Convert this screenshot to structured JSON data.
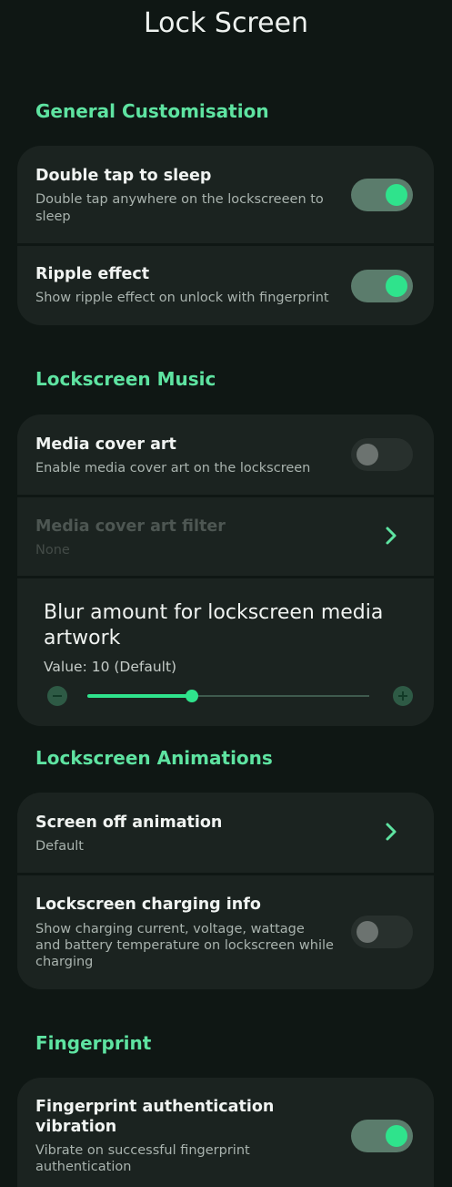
{
  "page_title": "Lock Screen",
  "accent_color": "#5ee3a1",
  "sections": {
    "general": {
      "header": "General Customisation",
      "items": [
        {
          "title": "Double tap to sleep",
          "subtitle_lines": [
            "Double tap anywhere on the lockscreeen to",
            "sleep"
          ],
          "toggle": true
        },
        {
          "title": "Ripple effect",
          "subtitle_lines": [
            "Show ripple effect on unlock with fingerprint"
          ],
          "toggle": true
        }
      ]
    },
    "music": {
      "header": "Lockscreen Music",
      "items": [
        {
          "title": "Media cover art",
          "subtitle_lines": [
            "Enable media cover art on the lockscreen"
          ],
          "toggle": false
        },
        {
          "title": "Media cover art filter",
          "subtitle_lines": [
            "None"
          ],
          "enabled": false,
          "icon": "chevron-right-icon"
        }
      ],
      "slider": {
        "title_lines": [
          "Blur amount for lockscreen media",
          "artwork"
        ],
        "value_text": "Value: 10 (Default)",
        "value_fraction": 0.37,
        "minus_icon": "minus-icon",
        "plus_icon": "plus-icon"
      }
    },
    "animations": {
      "header": "Lockscreen Animations",
      "items": [
        {
          "title": "Screen off animation",
          "subtitle_lines": [
            "Default"
          ],
          "icon": "chevron-right-icon"
        },
        {
          "title": "Lockscreen charging info",
          "subtitle_lines": [
            "Show charging current, voltage, wattage",
            "and battery temperature on lockscreen while",
            "charging"
          ],
          "toggle": false
        }
      ]
    },
    "fingerprint": {
      "header": "Fingerprint",
      "items": [
        {
          "title_lines": [
            "Fingerprint authentication",
            "vibration"
          ],
          "subtitle_lines": [
            "Vibrate on successful fingerprint",
            "authentication"
          ],
          "toggle": true
        }
      ]
    }
  }
}
